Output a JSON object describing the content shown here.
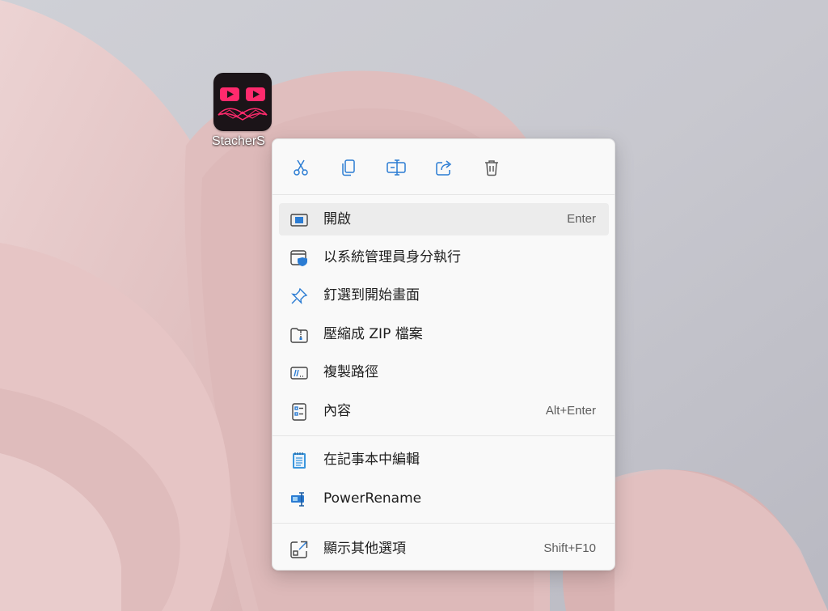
{
  "desktop": {
    "icon_label": "StacherS",
    "icon_name": "stacher-app-icon"
  },
  "context_menu": {
    "quick_actions": [
      {
        "name": "cut",
        "icon": "scissors-icon"
      },
      {
        "name": "copy",
        "icon": "copy-icon"
      },
      {
        "name": "rename",
        "icon": "rename-icon"
      },
      {
        "name": "share",
        "icon": "share-icon"
      },
      {
        "name": "delete",
        "icon": "trash-icon"
      }
    ],
    "items": [
      {
        "label": "開啟",
        "shortcut": "Enter",
        "icon": "open-window-icon"
      },
      {
        "label": "以系統管理員身分執行",
        "shortcut": "",
        "icon": "shield-window-icon"
      },
      {
        "label": "釘選到開始畫面",
        "shortcut": "",
        "icon": "pin-icon"
      },
      {
        "label": "壓縮成 ZIP 檔案",
        "shortcut": "",
        "icon": "zip-folder-icon"
      },
      {
        "label": "複製路徑",
        "shortcut": "",
        "icon": "copy-path-icon"
      },
      {
        "label": "內容",
        "shortcut": "Alt+Enter",
        "icon": "properties-icon"
      },
      {
        "label": "在記事本中編輯",
        "shortcut": "",
        "icon": "notepad-icon"
      },
      {
        "label": "PowerRename",
        "shortcut": "",
        "icon": "powerrename-icon"
      },
      {
        "label": "顯示其他選項",
        "shortcut": "Shift+F10",
        "icon": "more-options-icon"
      }
    ]
  },
  "colors": {
    "accent": "#2b7cd3",
    "menu_bg": "#f9f9f9",
    "hover_bg": "#ececec",
    "app_pink": "#ff2a6d"
  }
}
